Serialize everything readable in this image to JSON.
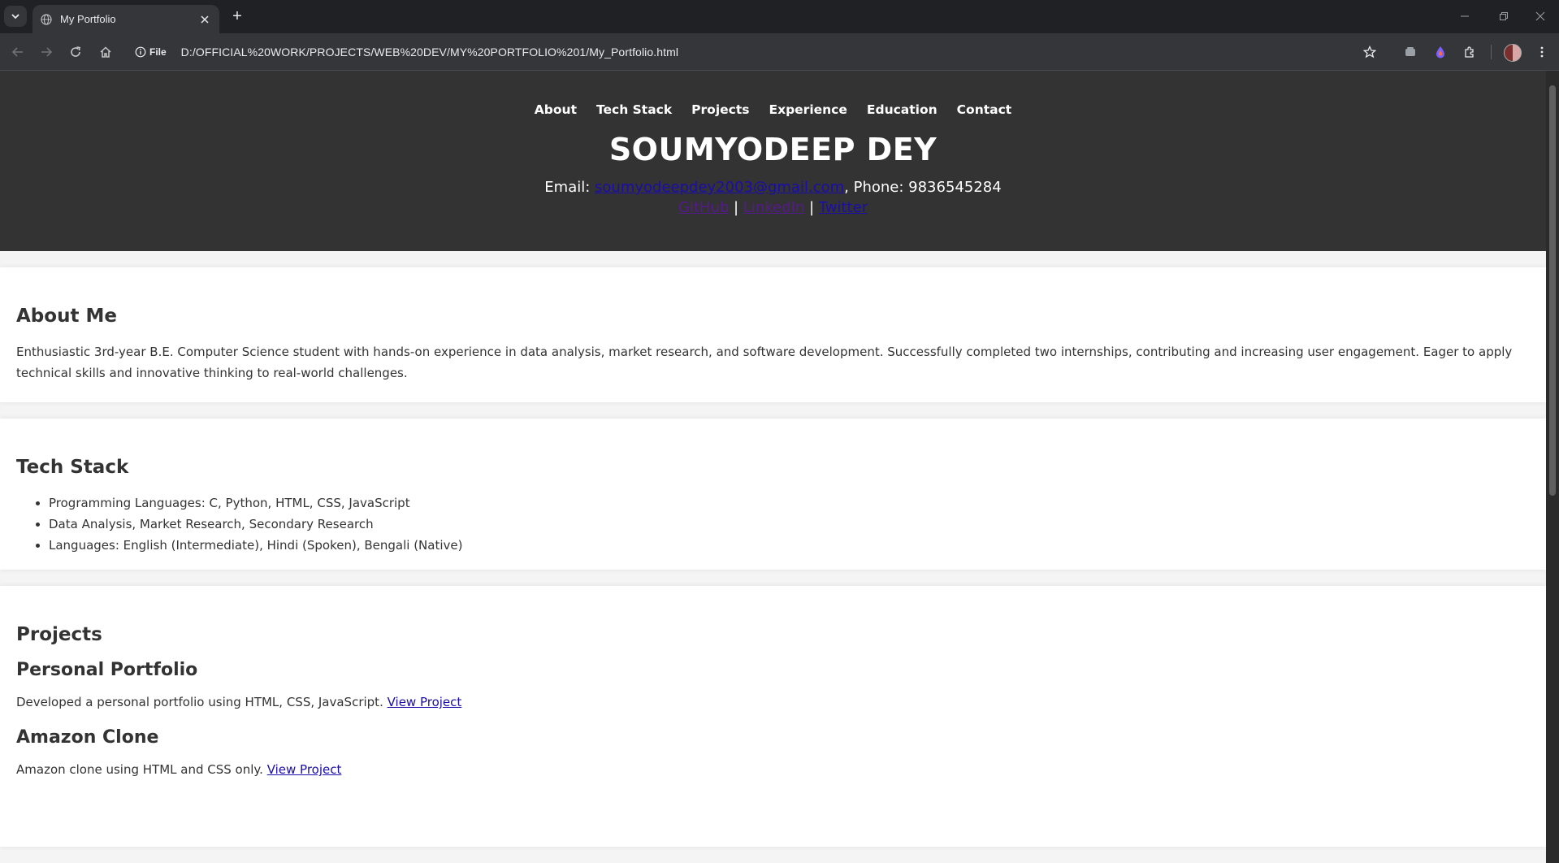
{
  "browser": {
    "tab_title": "My Portfolio",
    "new_tab_symbol": "+",
    "site_chip_label": "File",
    "url": "D:/OFFICIAL%20WORK/PROJECTS/WEB%20DEV/MY%20PORTFOLIO%201/My_Portfolio.html"
  },
  "nav": {
    "items": [
      "About",
      "Tech Stack",
      "Projects",
      "Experience",
      "Education",
      "Contact"
    ]
  },
  "header": {
    "name": "SOUMYODEEP DEY",
    "email_label": "Email: ",
    "email": "soumyodeepdey2003@gmail.com",
    "phone_label": ", Phone: ",
    "phone": "9836545284",
    "links": [
      "GitHub",
      "LinkedIn",
      "Twitter"
    ],
    "separator": " | "
  },
  "about": {
    "heading": "About Me",
    "text": "Enthusiastic 3rd-year B.E. Computer Science student with hands-on experience in data analysis, market research, and software development. Successfully completed two internships, contributing and increasing user engagement. Eager to apply technical skills and innovative thinking to real-world challenges."
  },
  "tech_stack": {
    "heading": "Tech Stack",
    "items": [
      "Programming Languages: C, Python, HTML, CSS, JavaScript",
      "Data Analysis, Market Research, Secondary Research",
      "Languages: English (Intermediate), Hindi (Spoken), Bengali (Native)"
    ]
  },
  "projects": {
    "heading": "Projects",
    "list": [
      {
        "title": "Personal Portfolio",
        "desc": "Developed a personal portfolio using HTML, CSS, JavaScript. ",
        "link": "View Project"
      },
      {
        "title": "Amazon Clone",
        "desc": "Amazon clone using HTML and CSS only. ",
        "link": "View Project"
      }
    ]
  },
  "colors": {
    "header_bg": "#333333",
    "link": "#1a0dab",
    "visited_link": "#551a8b",
    "chrome_bg": "#202124"
  }
}
